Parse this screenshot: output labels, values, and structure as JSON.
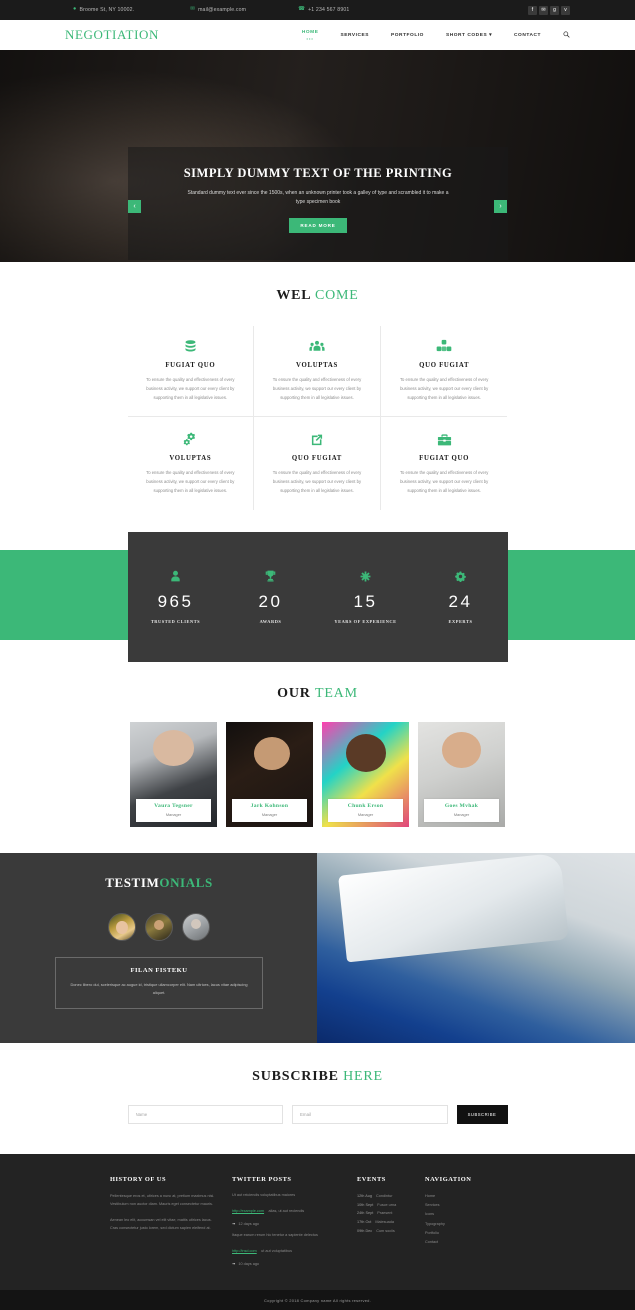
{
  "topbar": {
    "address": "Broome St, NY 10002.",
    "email": "mail@example.com",
    "phone": "+1 234 567 8901",
    "address_icon": "map-marker-icon",
    "email_icon": "envelope-icon",
    "phone_icon": "phone-icon",
    "socials": [
      {
        "name": "facebook-icon",
        "glyph": "f"
      },
      {
        "name": "twitter-icon",
        "glyph": "✉"
      },
      {
        "name": "google-plus-icon",
        "glyph": "g"
      },
      {
        "name": "vimeo-icon",
        "glyph": "v"
      }
    ]
  },
  "nav": {
    "brand": "NEGOTIATION",
    "items": [
      {
        "label": "HOME",
        "active": true
      },
      {
        "label": "SERVICES",
        "active": false
      },
      {
        "label": "PORTFOLIO",
        "active": false
      },
      {
        "label": "SHORT CODES ▾",
        "active": false
      },
      {
        "label": "CONTACT",
        "active": false
      }
    ],
    "search_icon": "search-icon"
  },
  "banner": {
    "title": "SIMPLY DUMMY TEXT OF THE PRINTING",
    "subtitle": "Standard dummy text ever since the 1500s, when an unknown printer took a galley of type and scrambled it to make a type specimen book",
    "button": "READ MORE",
    "prev": "‹",
    "next": "›"
  },
  "welcome": {
    "heading_bold": "WEL",
    "heading_light": "COME",
    "body": "To ensure the quality and effectiveness of every business activity, we support our every client by supporting them in all legislative issues.",
    "services": [
      {
        "title": "FUGIAT QUO",
        "icon": "database-icon"
      },
      {
        "title": "VOLUPTAS",
        "icon": "users-group-icon"
      },
      {
        "title": "QUO FUGIAT",
        "icon": "cubes-icon"
      },
      {
        "title": "VOLUPTAS",
        "icon": "cogs-icon"
      },
      {
        "title": "QUO FUGIAT",
        "icon": "external-link-icon"
      },
      {
        "title": "FUGIAT QUO",
        "icon": "briefcase-icon"
      }
    ]
  },
  "stats": {
    "accent_color": "#3cb878",
    "box_color": "#3a3a3a",
    "items": [
      {
        "icon": "user-icon",
        "value": "965",
        "label": "TRUSTED CLIENTS"
      },
      {
        "icon": "trophy-icon",
        "value": "20",
        "label": "AWARDS"
      },
      {
        "icon": "asterisk-icon",
        "value": "15",
        "label": "YEARS OF EXPERIENCE"
      },
      {
        "icon": "gear-icon",
        "value": "24",
        "label": "EXPERTS"
      }
    ]
  },
  "team": {
    "heading_bold": "OUR",
    "heading_light": "TEAM",
    "members": [
      {
        "name": "Vaura Tegsner",
        "role": "Manager"
      },
      {
        "name": "Jark Kohnson",
        "role": "Manager"
      },
      {
        "name": "Chunk Erson",
        "role": "Manager"
      },
      {
        "name": "Goes Mvhak",
        "role": "Manager"
      }
    ]
  },
  "testimonials": {
    "heading_bold": "TESTIM",
    "heading_light": "ONIALS",
    "avatars": [
      {
        "name": "testimonial-avatar-1"
      },
      {
        "name": "testimonial-avatar-2"
      },
      {
        "name": "testimonial-avatar-3"
      }
    ],
    "quote_name": "FILAN FISTEKU",
    "quote_text": "Donec libero dui, scelerisque ac augue id, tristique ullamcorper elit. Nam ultrices, lacus vitae adipiscing aliquet."
  },
  "subscribe": {
    "heading_bold": "SUBSCRIBE",
    "heading_light": "HERE",
    "name_placeholder": "Name",
    "email_placeholder": "Email",
    "button": "SUBSCRIBE"
  },
  "footer": {
    "history": {
      "heading": "HISTORY OF US",
      "p1": "Pellentesque eros et, ultrices a nunc at, pretium maximus nisi. Vestibulum non auctor diam. Mauris eget consectetur mauris.",
      "p2": "Aenean leo elit, accumsan vel elit vitae, mattis ultrices lacus. Cras consectetur justo lorem, sed dictum sapien eleifend at."
    },
    "twitter": {
      "heading": "TWITTER POSTS",
      "posts": [
        {
          "text": "Ut aut reiciendis voluptatibus maiores",
          "link": "http://example.com",
          "tail": "alias, ut aut reciendis",
          "meta": "12 days ago",
          "icon": "twitter-bird-icon"
        },
        {
          "text": "Itaque earum rerum hic tenetur a sapiente delectus",
          "link": "http://insd.com",
          "tail": "ut aut voluptatibus",
          "meta": "10 days ago",
          "icon": "twitter-bird-icon"
        }
      ]
    },
    "events": {
      "heading": "EVENTS",
      "items": [
        {
          "date": "12th Aug",
          "label": "Condintur"
        },
        {
          "date": "10th Sept",
          "label": "Fusce urna"
        },
        {
          "date": "24th Sept",
          "label": "Praesent"
        },
        {
          "date": "17th Oct",
          "label": "Malesuada"
        },
        {
          "date": "09th Dec",
          "label": "Cum sociis"
        }
      ]
    },
    "navigation": {
      "heading": "NAVIGATION",
      "items": [
        "Home",
        "Services",
        "Icons",
        "Typography",
        "Portfolio",
        "Contact"
      ]
    },
    "copyright": "Copyright © 2018 Company name All rights reserved."
  }
}
